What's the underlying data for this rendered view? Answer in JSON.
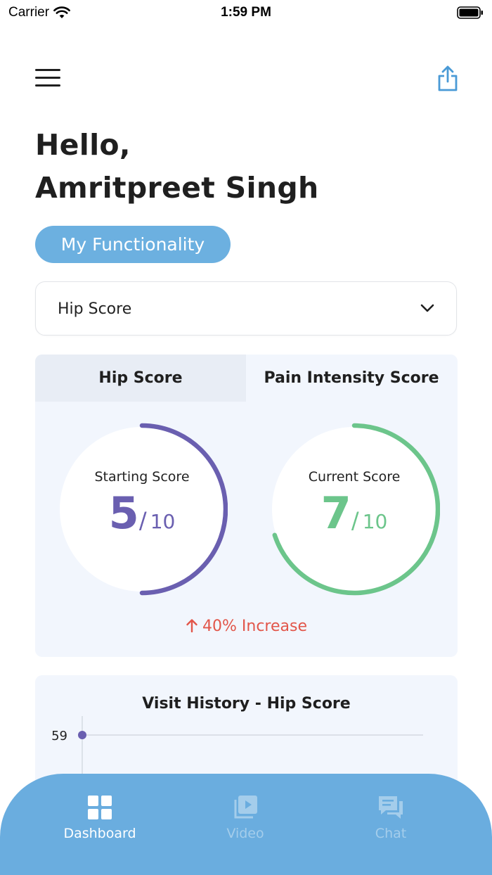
{
  "status_bar": {
    "carrier": "Carrier",
    "time": "1:59 PM"
  },
  "greeting": {
    "line1": "Hello,",
    "line2": "Amritpreet Singh"
  },
  "functionality_pill": "My Functionality",
  "dropdown": {
    "selected": "Hip Score"
  },
  "score_card": {
    "tabs": [
      {
        "label": "Hip Score",
        "active": true
      },
      {
        "label": "Pain Intensity Score",
        "active": false
      }
    ],
    "starting": {
      "caption": "Starting Score",
      "value": "5",
      "separator": "/",
      "max": "10",
      "fraction": 0.5,
      "color": "#6a5fb0"
    },
    "current": {
      "caption": "Current Score",
      "value": "7",
      "separator": "/",
      "max": "10",
      "fraction": 0.7,
      "color": "#6cc58b"
    },
    "change_text": "40% Increase",
    "change_color": "#e2564a"
  },
  "visit_history": {
    "title": "Visit History  - Hip Score",
    "y_tick": "59",
    "point_color": "#6a5fb0"
  },
  "tab_bar": {
    "items": [
      {
        "label": "Dashboard",
        "icon": "dashboard-grid-icon",
        "active": true
      },
      {
        "label": "Video",
        "icon": "video-play-icon",
        "active": false
      },
      {
        "label": "Chat",
        "icon": "chat-bubble-icon",
        "active": false
      }
    ],
    "background": "#6aaddf"
  }
}
